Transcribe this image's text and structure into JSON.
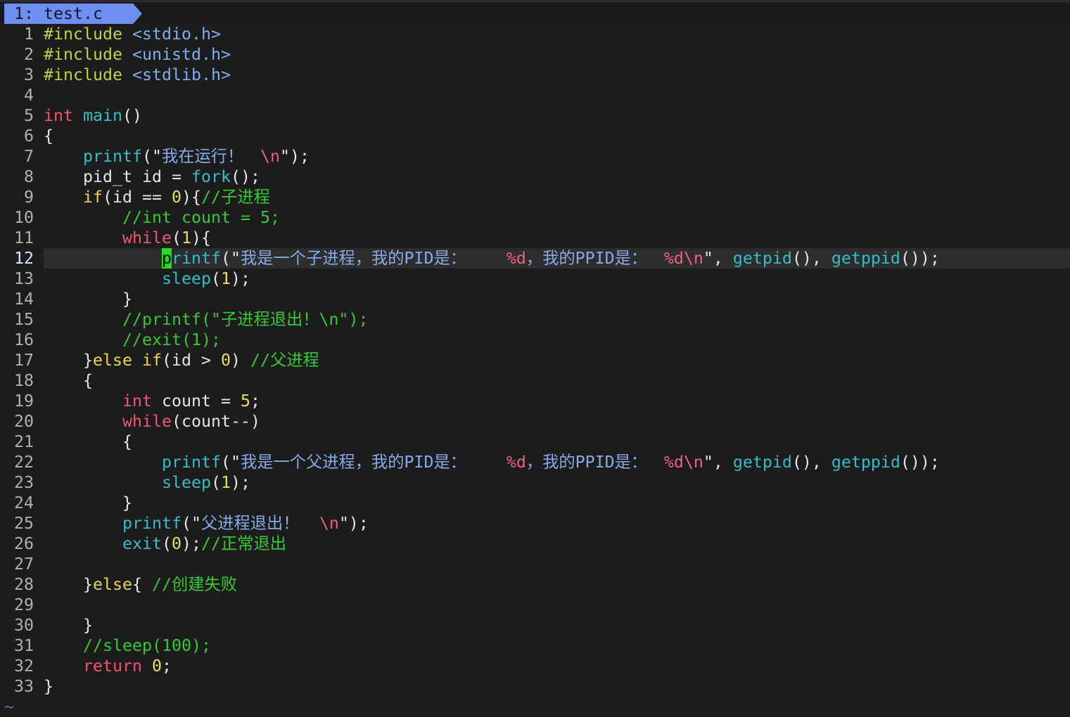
{
  "theme": {
    "background": "#1c1c1c",
    "current_line": "#2d2d2d",
    "line_number": "#b0b0b0",
    "current_line_number": "#dce8ff",
    "tab_background": "#6f8ff0",
    "tab_text": "#12152a",
    "filler": "#5f6f99"
  },
  "tabline": {
    "tab_label": "1: test.c"
  },
  "editor": {
    "filler": "~",
    "lines": [
      {
        "number": "1",
        "tokens": [
          {
            "text": "#include",
            "color": "#c2d23e"
          },
          {
            "text": " ",
            "color": "#e6e6e6"
          },
          {
            "text": "<stdio.h>",
            "color": "#7eaef0"
          }
        ]
      },
      {
        "number": "2",
        "tokens": [
          {
            "text": "#include",
            "color": "#c2d23e"
          },
          {
            "text": " ",
            "color": "#e6e6e6"
          },
          {
            "text": "<unistd.h>",
            "color": "#7eaef0"
          }
        ]
      },
      {
        "number": "3",
        "tokens": [
          {
            "text": "#include",
            "color": "#c2d23e"
          },
          {
            "text": " ",
            "color": "#e6e6e6"
          },
          {
            "text": "<stdlib.h>",
            "color": "#7eaef0"
          }
        ]
      },
      {
        "number": "4",
        "tokens": []
      },
      {
        "number": "5",
        "tokens": [
          {
            "text": "int",
            "color": "#f2556f"
          },
          {
            "text": " ",
            "color": "#e6e6e6"
          },
          {
            "text": "main",
            "color": "#33bec8"
          },
          {
            "text": "()",
            "color": "#e6e6e6"
          }
        ]
      },
      {
        "number": "6",
        "tokens": [
          {
            "text": "{",
            "color": "#e6e6e6"
          }
        ]
      },
      {
        "number": "7",
        "tokens": [
          {
            "text": "    printf",
            "color": "#33bec8"
          },
          {
            "text": "(\"",
            "color": "#e6e6e6"
          },
          {
            "text": "我在运行！",
            "color": "#86aaea"
          },
          {
            "text": "\\n",
            "color": "#f2607e"
          },
          {
            "text": "\");",
            "color": "#e6e6e6"
          }
        ]
      },
      {
        "number": "8",
        "tokens": [
          {
            "text": "    pid_t id = ",
            "color": "#e6e6e6"
          },
          {
            "text": "fork",
            "color": "#33bec8"
          },
          {
            "text": "();",
            "color": "#e6e6e6"
          }
        ]
      },
      {
        "number": "9",
        "tokens": [
          {
            "text": "    if",
            "color": "#ecd44e"
          },
          {
            "text": "(id == ",
            "color": "#e6e6e6"
          },
          {
            "text": "0",
            "color": "#eedc5c"
          },
          {
            "text": "){",
            "color": "#e6e6e6"
          },
          {
            "text": "//子进程",
            "color": "#35c935"
          }
        ]
      },
      {
        "number": "10",
        "tokens": [
          {
            "text": "        //int count = 5;",
            "color": "#35c935"
          }
        ]
      },
      {
        "number": "11",
        "tokens": [
          {
            "text": "        while",
            "color": "#f2556f"
          },
          {
            "text": "(",
            "color": "#e6e6e6"
          },
          {
            "text": "1",
            "color": "#eedc5c"
          },
          {
            "text": "){",
            "color": "#e6e6e6"
          }
        ]
      },
      {
        "number": "12",
        "current": true,
        "tokens": [
          {
            "text": "            ",
            "color": "#e6e6e6"
          },
          {
            "text": "p",
            "color": "#000000",
            "bg": "#1fe01f"
          },
          {
            "text": "rintf",
            "color": "#33bec8"
          },
          {
            "text": "(\"",
            "color": "#e6e6e6"
          },
          {
            "text": "我是一个子进程，我的PID是：",
            "color": "#86aaea"
          },
          {
            "text": "%d",
            "color": "#f2607e"
          },
          {
            "text": "，我的PPID是：",
            "color": "#86aaea"
          },
          {
            "text": "%d\\n",
            "color": "#f2607e"
          },
          {
            "text": "\", ",
            "color": "#e6e6e6"
          },
          {
            "text": "getpid",
            "color": "#33bec8"
          },
          {
            "text": "(), ",
            "color": "#e6e6e6"
          },
          {
            "text": "getppid",
            "color": "#33bec8"
          },
          {
            "text": "());",
            "color": "#e6e6e6"
          }
        ]
      },
      {
        "number": "13",
        "tokens": [
          {
            "text": "            sleep",
            "color": "#33bec8"
          },
          {
            "text": "(",
            "color": "#e6e6e6"
          },
          {
            "text": "1",
            "color": "#eedc5c"
          },
          {
            "text": ");",
            "color": "#e6e6e6"
          }
        ]
      },
      {
        "number": "14",
        "tokens": [
          {
            "text": "        }",
            "color": "#e6e6e6"
          }
        ]
      },
      {
        "number": "15",
        "tokens": [
          {
            "text": "        //printf(\"子进程退出！\\n\");",
            "color": "#35c935"
          }
        ]
      },
      {
        "number": "16",
        "tokens": [
          {
            "text": "        //exit(1);",
            "color": "#35c935"
          }
        ]
      },
      {
        "number": "17",
        "tokens": [
          {
            "text": "    }",
            "color": "#e6e6e6"
          },
          {
            "text": "else",
            "color": "#ecd44e"
          },
          {
            "text": " ",
            "color": "#e6e6e6"
          },
          {
            "text": "if",
            "color": "#ecd44e"
          },
          {
            "text": "(id > ",
            "color": "#e6e6e6"
          },
          {
            "text": "0",
            "color": "#eedc5c"
          },
          {
            "text": ") ",
            "color": "#e6e6e6"
          },
          {
            "text": "//父进程",
            "color": "#35c935"
          }
        ]
      },
      {
        "number": "18",
        "tokens": [
          {
            "text": "    {",
            "color": "#e6e6e6"
          }
        ]
      },
      {
        "number": "19",
        "tokens": [
          {
            "text": "        int",
            "color": "#f2556f"
          },
          {
            "text": " count = ",
            "color": "#e6e6e6"
          },
          {
            "text": "5",
            "color": "#eedc5c"
          },
          {
            "text": ";",
            "color": "#e6e6e6"
          }
        ]
      },
      {
        "number": "20",
        "tokens": [
          {
            "text": "        while",
            "color": "#f2556f"
          },
          {
            "text": "(count--)",
            "color": "#e6e6e6"
          }
        ]
      },
      {
        "number": "21",
        "tokens": [
          {
            "text": "        {",
            "color": "#e6e6e6"
          }
        ]
      },
      {
        "number": "22",
        "tokens": [
          {
            "text": "            printf",
            "color": "#33bec8"
          },
          {
            "text": "(\"",
            "color": "#e6e6e6"
          },
          {
            "text": "我是一个父进程，我的PID是：",
            "color": "#86aaea"
          },
          {
            "text": "%d",
            "color": "#f2607e"
          },
          {
            "text": "，我的PPID是：",
            "color": "#86aaea"
          },
          {
            "text": "%d\\n",
            "color": "#f2607e"
          },
          {
            "text": "\", ",
            "color": "#e6e6e6"
          },
          {
            "text": "getpid",
            "color": "#33bec8"
          },
          {
            "text": "(), ",
            "color": "#e6e6e6"
          },
          {
            "text": "getppid",
            "color": "#33bec8"
          },
          {
            "text": "());",
            "color": "#e6e6e6"
          }
        ]
      },
      {
        "number": "23",
        "tokens": [
          {
            "text": "            sleep",
            "color": "#33bec8"
          },
          {
            "text": "(",
            "color": "#e6e6e6"
          },
          {
            "text": "1",
            "color": "#eedc5c"
          },
          {
            "text": ");",
            "color": "#e6e6e6"
          }
        ]
      },
      {
        "number": "24",
        "tokens": [
          {
            "text": "        }",
            "color": "#e6e6e6"
          }
        ]
      },
      {
        "number": "25",
        "tokens": [
          {
            "text": "        printf",
            "color": "#33bec8"
          },
          {
            "text": "(\"",
            "color": "#e6e6e6"
          },
          {
            "text": "父进程退出！",
            "color": "#86aaea"
          },
          {
            "text": "\\n",
            "color": "#f2607e"
          },
          {
            "text": "\");",
            "color": "#e6e6e6"
          }
        ]
      },
      {
        "number": "26",
        "tokens": [
          {
            "text": "        exit",
            "color": "#33bec8"
          },
          {
            "text": "(",
            "color": "#e6e6e6"
          },
          {
            "text": "0",
            "color": "#eedc5c"
          },
          {
            "text": ");",
            "color": "#e6e6e6"
          },
          {
            "text": "//正常退出",
            "color": "#35c935"
          }
        ]
      },
      {
        "number": "27",
        "tokens": []
      },
      {
        "number": "28",
        "tokens": [
          {
            "text": "    }",
            "color": "#e6e6e6"
          },
          {
            "text": "else",
            "color": "#ecd44e"
          },
          {
            "text": "{ ",
            "color": "#e6e6e6"
          },
          {
            "text": "//创建失败",
            "color": "#35c935"
          }
        ]
      },
      {
        "number": "29",
        "tokens": []
      },
      {
        "number": "30",
        "tokens": [
          {
            "text": "    }",
            "color": "#e6e6e6"
          }
        ]
      },
      {
        "number": "31",
        "tokens": [
          {
            "text": "    //sleep(100);",
            "color": "#35c935"
          }
        ]
      },
      {
        "number": "32",
        "tokens": [
          {
            "text": "    return",
            "color": "#f2556f"
          },
          {
            "text": " ",
            "color": "#e6e6e6"
          },
          {
            "text": "0",
            "color": "#eedc5c"
          },
          {
            "text": ";",
            "color": "#e6e6e6"
          }
        ]
      },
      {
        "number": "33",
        "tokens": [
          {
            "text": "}",
            "color": "#e6e6e6"
          }
        ]
      }
    ]
  }
}
